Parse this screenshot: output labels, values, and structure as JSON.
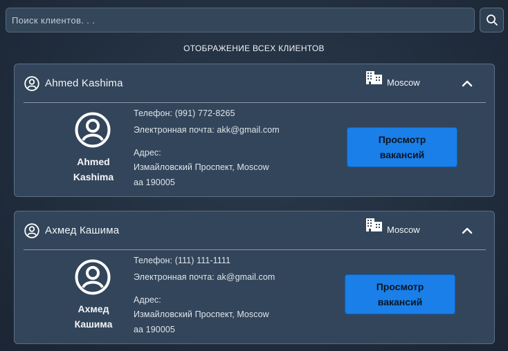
{
  "search": {
    "placeholder": "Поиск клиентов. . ."
  },
  "heading": "ОТОБРАЖЕНИЕ ВСЕХ КЛИЕНТОВ",
  "clients": [
    {
      "name": "Ahmed Kashima",
      "name_line1": "Ahmed",
      "name_line2": "Kashima",
      "city": "Moscow",
      "phone": "Телефон: (991) 772-8265",
      "email": "Электронная почта: akk@gmail.com",
      "address_label": "Адрес:",
      "address_line1": "Измайловский Проспект, Moscow",
      "address_line2": "aa 190005",
      "button_line1": "Просмотр",
      "button_line2": "вакансий"
    },
    {
      "name": "Ахмед Кашима",
      "name_line1": "Ахмед",
      "name_line2": "Кашима",
      "city": "Moscow",
      "phone": "Телефон: (111) 111-1111",
      "email": "Электронная почта: ak@gmail.com",
      "address_label": "Адрес:",
      "address_line1": "Измайловский Проспект, Moscow",
      "address_line2": "aa 190005",
      "button_line1": "Просмотр",
      "button_line2": "вакансий"
    }
  ],
  "icons": {
    "search": "search-icon",
    "user": "user-circle-icon",
    "city": "buildings-icon",
    "collapse": "chevron-up-icon"
  }
}
